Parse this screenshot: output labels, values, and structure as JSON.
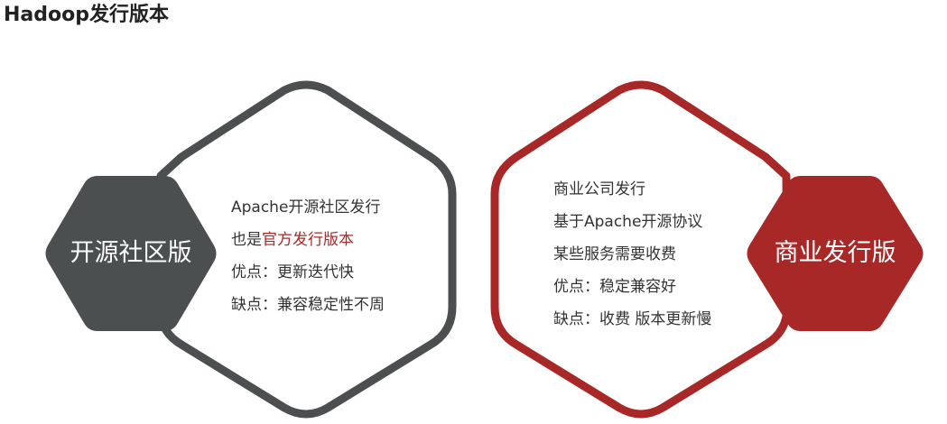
{
  "title": "Hadoop发行版本",
  "colors": {
    "open_source": "#4b4f4f",
    "commercial": "#a82828",
    "highlight": "#a52a2a",
    "text": "#333333"
  },
  "open_source": {
    "label": "开源社区版",
    "lines": [
      {
        "text": "Apache开源社区发行"
      },
      {
        "prefix": "也是",
        "highlight": "官方发行版本"
      },
      {
        "text": "优点：更新迭代快"
      },
      {
        "text": "缺点：兼容稳定性不周"
      }
    ]
  },
  "commercial": {
    "label": "商业发行版",
    "lines": [
      {
        "text": "商业公司发行"
      },
      {
        "text": "基于Apache开源协议"
      },
      {
        "text": "某些服务需要收费"
      },
      {
        "text": "优点：稳定兼容好"
      },
      {
        "text": "缺点：收费 版本更新慢"
      }
    ]
  }
}
